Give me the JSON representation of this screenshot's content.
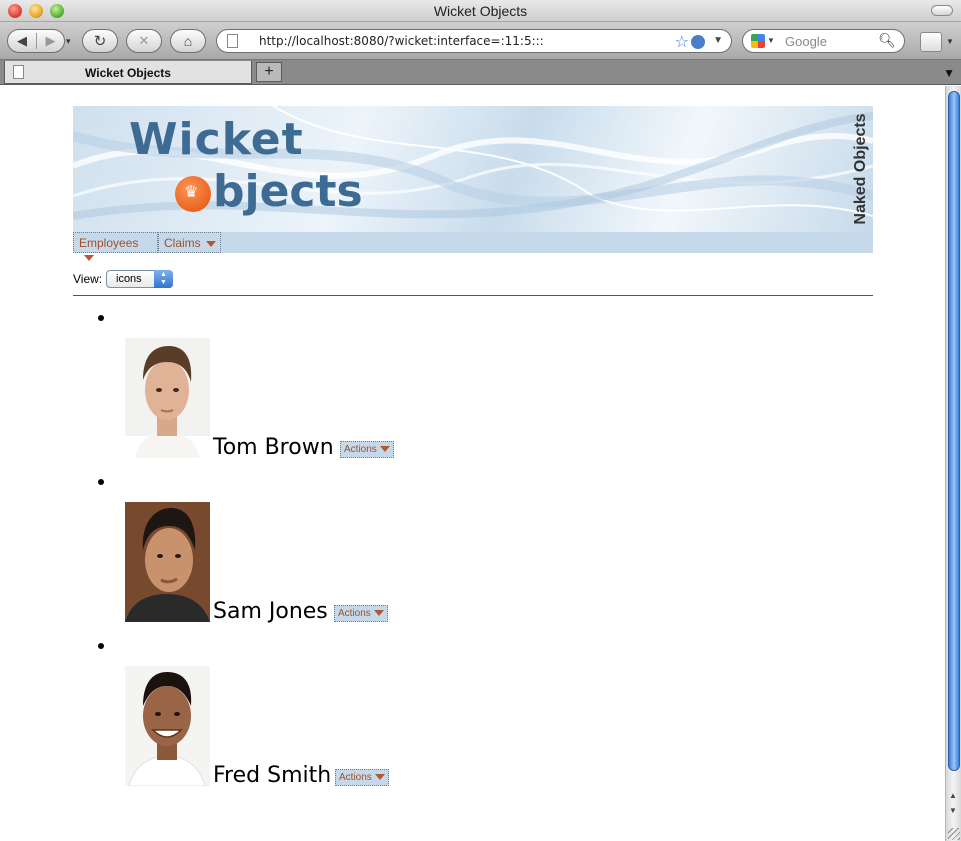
{
  "window": {
    "title": "Wicket Objects"
  },
  "toolbar": {
    "url": "http://localhost:8080/?wicket:interface=:11:5:::",
    "search_placeholder": "Google"
  },
  "tabs": [
    {
      "label": "Wicket Objects"
    }
  ],
  "newtab_label": "+",
  "banner": {
    "logo_word1": "Wicket",
    "logo_word2": "bjects",
    "side_text": "Naked Objects"
  },
  "menu": [
    {
      "label": "Employees"
    },
    {
      "label": "Claims"
    }
  ],
  "view": {
    "label": "View:",
    "selected": "icons"
  },
  "people": [
    {
      "name": "Tom Brown",
      "actions_label": "Actions"
    },
    {
      "name": "Sam Jones",
      "actions_label": "Actions"
    },
    {
      "name": "Fred Smith",
      "actions_label": "Actions"
    }
  ],
  "colors": {
    "accent": "#3e6b93",
    "menu_bg": "#c5d9ea",
    "menu_text": "#a0502a"
  }
}
